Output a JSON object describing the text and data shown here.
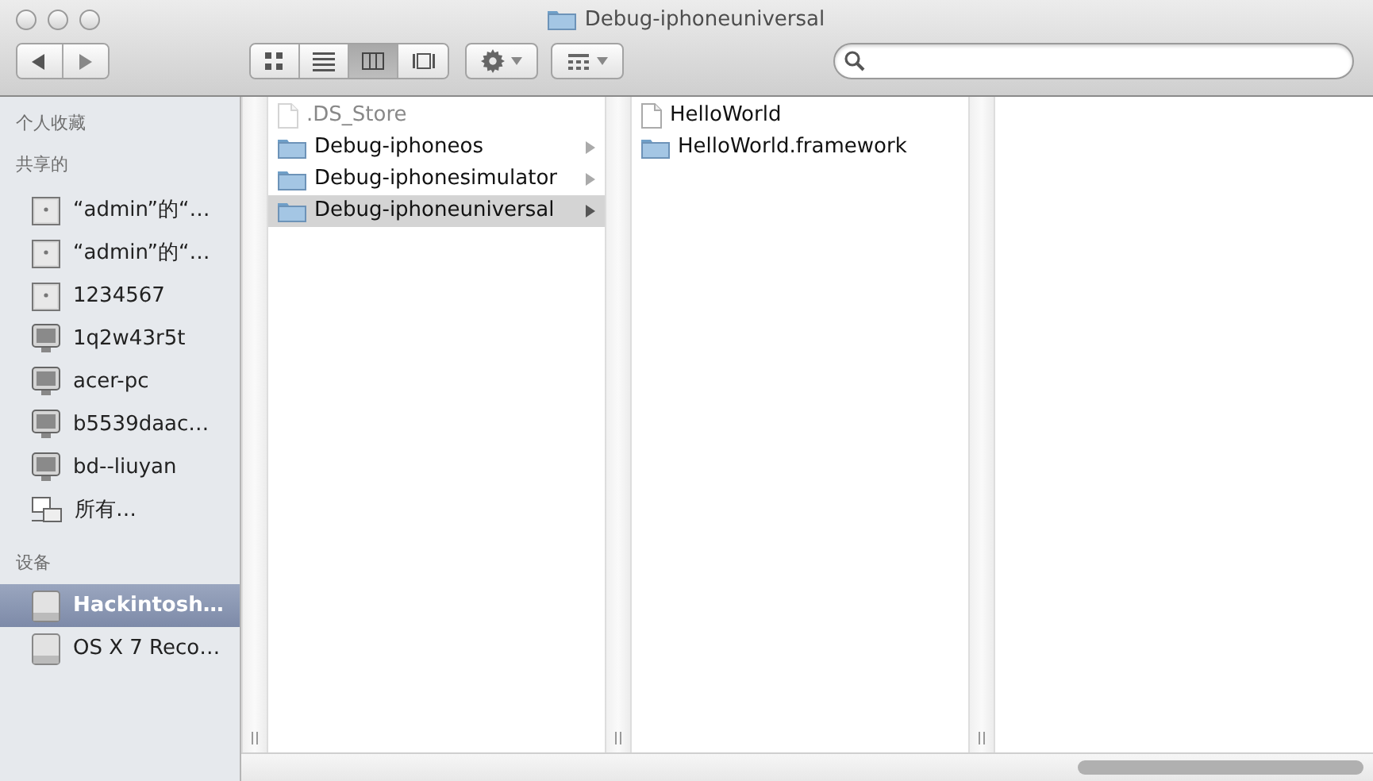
{
  "window": {
    "title": "Debug-iphoneuniversal"
  },
  "toolbar": {
    "view_modes": [
      {
        "kind": "icons",
        "selected": false
      },
      {
        "kind": "list",
        "selected": false
      },
      {
        "kind": "columns",
        "selected": true
      },
      {
        "kind": "coverflow",
        "selected": false
      }
    ]
  },
  "sidebar": {
    "sections": [
      {
        "title": "个人收藏"
      },
      {
        "title": "共享的",
        "items": [
          {
            "label": "“admin”的“…",
            "kind": "server",
            "selected": false
          },
          {
            "label": "“admin”的“…",
            "kind": "server",
            "selected": false
          },
          {
            "label": "1234567",
            "kind": "server",
            "selected": false
          },
          {
            "label": "1q2w43r5t",
            "kind": "monitor",
            "selected": false
          },
          {
            "label": "acer-pc",
            "kind": "monitor",
            "selected": false
          },
          {
            "label": "b5539daac…",
            "kind": "monitor",
            "selected": false
          },
          {
            "label": "bd--liuyan",
            "kind": "monitor",
            "selected": false
          },
          {
            "label": "所有…",
            "kind": "network",
            "selected": false
          }
        ]
      },
      {
        "title": "设备",
        "items": [
          {
            "label": "Hackintosh…",
            "kind": "drive",
            "selected": true
          },
          {
            "label": "OS X 7 Reco…",
            "kind": "drive",
            "selected": false
          }
        ]
      }
    ]
  },
  "columns": [
    {
      "items": [
        {
          "label": ".DS_Store",
          "kind": "file",
          "dimmed": true,
          "expandable": false,
          "selected": false
        },
        {
          "label": "Debug-iphoneos",
          "kind": "folder",
          "dimmed": false,
          "expandable": true,
          "selected": false
        },
        {
          "label": "Debug-iphonesimulator",
          "kind": "folder",
          "dimmed": false,
          "expandable": true,
          "selected": false
        },
        {
          "label": "Debug-iphoneuniversal",
          "kind": "folder",
          "dimmed": false,
          "expandable": true,
          "selected": true
        }
      ]
    },
    {
      "items": [
        {
          "label": "HelloWorld",
          "kind": "file",
          "dimmed": false,
          "expandable": false,
          "selected": false
        },
        {
          "label": "HelloWorld.framework",
          "kind": "folder",
          "dimmed": false,
          "expandable": false,
          "selected": false
        }
      ]
    }
  ]
}
